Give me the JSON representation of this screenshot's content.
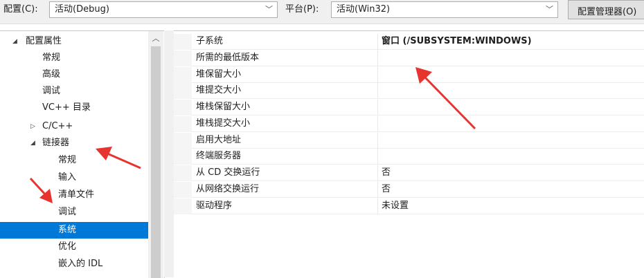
{
  "toolbar": {
    "config_label": "配置(C):",
    "config_value": "活动(Debug)",
    "platform_label": "平台(P):",
    "platform_value": "活动(Win32)",
    "manager_button": "配置管理器(O)"
  },
  "tree": {
    "items": [
      {
        "label": "配置属性",
        "expander": "◢"
      },
      {
        "label": "常规"
      },
      {
        "label": "高级"
      },
      {
        "label": "调试"
      },
      {
        "label": "VC++ 目录"
      },
      {
        "label": "C/C++",
        "expander": "▷"
      },
      {
        "label": "链接器",
        "expander": "◢"
      },
      {
        "label": "常规"
      },
      {
        "label": "输入"
      },
      {
        "label": "清单文件"
      },
      {
        "label": "调试"
      },
      {
        "label": "系统"
      },
      {
        "label": "优化"
      },
      {
        "label": "嵌入的 IDL"
      }
    ]
  },
  "properties": {
    "rows": [
      {
        "name": "子系统",
        "value": "窗口 (/SUBSYSTEM:WINDOWS)"
      },
      {
        "name": "所需的最低版本",
        "value": ""
      },
      {
        "name": "堆保留大小",
        "value": ""
      },
      {
        "name": "堆提交大小",
        "value": ""
      },
      {
        "name": "堆栈保留大小",
        "value": ""
      },
      {
        "name": "堆栈提交大小",
        "value": ""
      },
      {
        "name": "启用大地址",
        "value": ""
      },
      {
        "name": "终端服务器",
        "value": ""
      },
      {
        "name": "从 CD 交换运行",
        "value": "否"
      },
      {
        "name": "从网络交换运行",
        "value": "否"
      },
      {
        "name": "驱动程序",
        "value": "未设置"
      }
    ]
  },
  "colors": {
    "selection": "#0078d7",
    "annotation_arrow": "#e8342e"
  }
}
